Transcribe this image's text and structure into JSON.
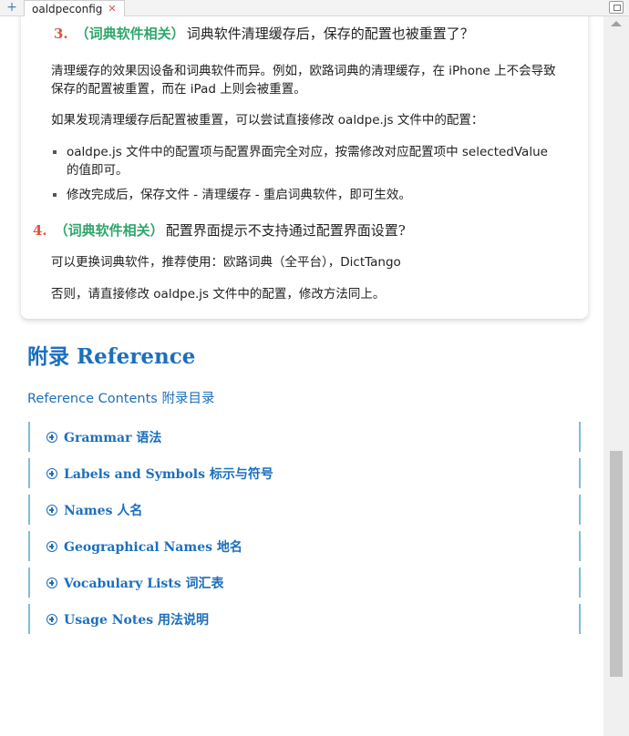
{
  "tabbar": {
    "add_icon": "plus-icon",
    "tab_title": "oaldpeconfig",
    "close_icon": "close-icon",
    "menu_icon": "window-restore-icon"
  },
  "faq": {
    "q3": {
      "number": "3.",
      "tag": "（词典软件相关）",
      "text": "词典软件清理缓存后，保存的配置也被重置了？"
    },
    "q3_p1": "清理缓存的效果因设备和词典软件而异。例如，欧路词典的清理缓存，在 iPhone 上不会导致保存的配置被重置，而在 iPad 上则会被重置。",
    "q3_p2": "如果发现清理缓存后配置被重置，可以尝试直接修改 oaldpe.js 文件中的配置：",
    "q3_list": [
      "oaldpe.js 文件中的配置项与配置界面完全对应，按需修改对应配置项中 selectedValue 的值即可。",
      "修改完成后，保存文件 - 清理缓存 - 重启词典软件，即可生效。"
    ],
    "q4": {
      "number": "4.",
      "tag": "（词典软件相关）",
      "text": "配置界面提示不支持通过配置界面设置?"
    },
    "q4_p1": "可以更换词典软件，推荐使用：欧路词典（全平台），DictTango",
    "q4_p2": "否则，请直接修改 oaldpe.js 文件中的配置，修改方法同上。"
  },
  "appendix": {
    "title": "附录 Reference",
    "contents_link": "Reference Contents 附录目录",
    "items": [
      {
        "label": "Grammar 语法"
      },
      {
        "label": "Labels and Symbols 标示与符号"
      },
      {
        "label": "Names 人名"
      },
      {
        "label": "Geographical Names 地名"
      },
      {
        "label": "Vocabulary Lists 词汇表"
      },
      {
        "label": "Usage Notes 用法说明"
      }
    ]
  },
  "colors": {
    "accent_blue": "#1c6fbd",
    "number_red": "#e0523a",
    "tag_green": "#2fa66b",
    "border_teal": "#7fbfd6"
  }
}
